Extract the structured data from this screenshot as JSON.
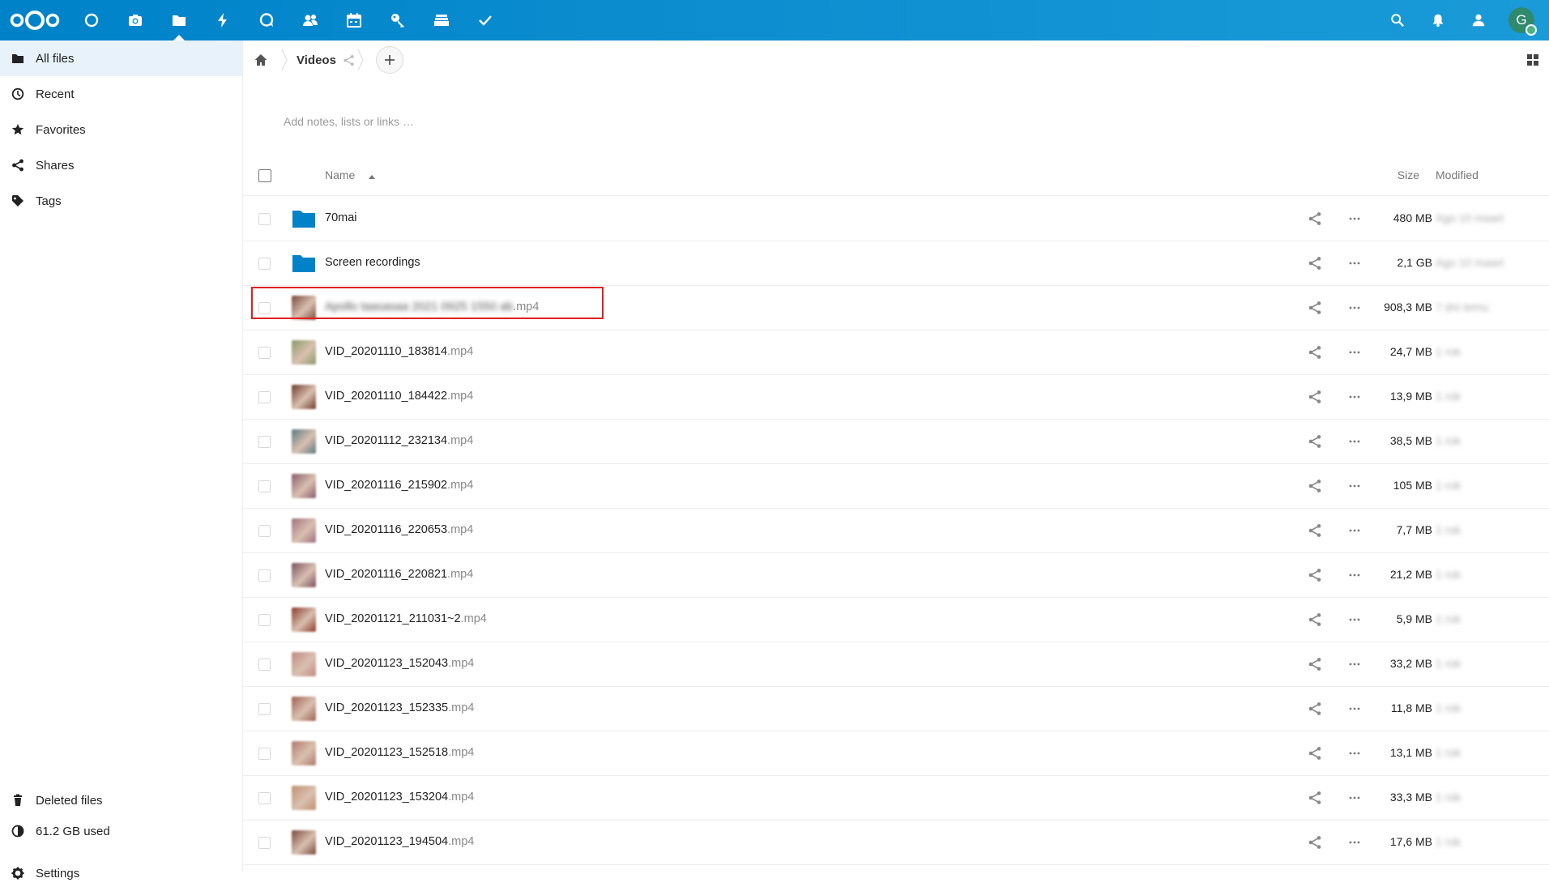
{
  "header": {
    "apps": [
      {
        "icon": "dashboard-icon"
      },
      {
        "icon": "photos-icon"
      },
      {
        "icon": "files-icon",
        "active": true
      },
      {
        "icon": "activity-icon"
      },
      {
        "icon": "talk-icon"
      },
      {
        "icon": "contacts-icon"
      },
      {
        "icon": "calendar-icon"
      },
      {
        "icon": "passwords-icon"
      },
      {
        "icon": "deck-icon"
      },
      {
        "icon": "tasks-icon"
      }
    ],
    "right": [
      "search-icon",
      "notifications-icon",
      "contacts-menu-icon"
    ],
    "avatar_initial": "G"
  },
  "sidebar": {
    "items": [
      {
        "label": "All files",
        "icon": "folder-icon",
        "active": true
      },
      {
        "label": "Recent",
        "icon": "clock-icon"
      },
      {
        "label": "Favorites",
        "icon": "star-icon"
      },
      {
        "label": "Shares",
        "icon": "share-icon"
      },
      {
        "label": "Tags",
        "icon": "tag-icon"
      }
    ],
    "bottom": {
      "deleted": "Deleted files",
      "quota": "61.2 GB used",
      "settings": "Settings"
    }
  },
  "breadcrumb": {
    "current": "Videos"
  },
  "notes_placeholder": "Add notes, lists or links …",
  "table": {
    "headers": {
      "name": "Name",
      "size": "Size",
      "modified": "Modified"
    },
    "rows": [
      {
        "type": "folder",
        "name": "70mai",
        "ext": "",
        "size": "480 MB",
        "modified": "Ago 10 maart",
        "thumb": "#0082c9"
      },
      {
        "type": "folder",
        "name": "Screen recordings",
        "ext": "",
        "size": "2,1 GB",
        "modified": "Ago 10 maart",
        "thumb": "#0082c9"
      },
      {
        "type": "file",
        "name": "Apollo taasasaa 2021 0925 1550 ab",
        "ext": ".mp4",
        "size": "908,3 MB",
        "modified": "7 dni temu",
        "thumb": "#7a4a3c",
        "blurred": true
      },
      {
        "type": "file",
        "name": "VID_20201110_183814",
        "ext": ".mp4",
        "size": "24,7 MB",
        "modified": "1 rok",
        "thumb": "#8a9a6a"
      },
      {
        "type": "file",
        "name": "VID_20201110_184422",
        "ext": ".mp4",
        "size": "13,9 MB",
        "modified": "1 rok",
        "thumb": "#6e3b2a"
      },
      {
        "type": "file",
        "name": "VID_20201112_232134",
        "ext": ".mp4",
        "size": "38,5 MB",
        "modified": "1 rok",
        "thumb": "#5a7a80"
      },
      {
        "type": "file",
        "name": "VID_20201116_215902",
        "ext": ".mp4",
        "size": "105 MB",
        "modified": "1 rok",
        "thumb": "#8a5a6a"
      },
      {
        "type": "file",
        "name": "VID_20201116_220653",
        "ext": ".mp4",
        "size": "7,7 MB",
        "modified": "1 rok",
        "thumb": "#a07080"
      },
      {
        "type": "file",
        "name": "VID_20201116_220821",
        "ext": ".mp4",
        "size": "21,2 MB",
        "modified": "1 rok",
        "thumb": "#7a5060"
      },
      {
        "type": "file",
        "name": "VID_20201121_211031~2",
        "ext": ".mp4",
        "size": "5,9 MB",
        "modified": "1 rok",
        "thumb": "#8a3a2a"
      },
      {
        "type": "file",
        "name": "VID_20201123_152043",
        "ext": ".mp4",
        "size": "33,2 MB",
        "modified": "1 rok",
        "thumb": "#c08a80"
      },
      {
        "type": "file",
        "name": "VID_20201123_152335",
        "ext": ".mp4",
        "size": "11,8 MB",
        "modified": "1 rok",
        "thumb": "#a06050"
      },
      {
        "type": "file",
        "name": "VID_20201123_152518",
        "ext": ".mp4",
        "size": "13,1 MB",
        "modified": "1 rok",
        "thumb": "#b07a6a"
      },
      {
        "type": "file",
        "name": "VID_20201123_153204",
        "ext": ".mp4",
        "size": "33,3 MB",
        "modified": "1 rok",
        "thumb": "#c09070"
      },
      {
        "type": "file",
        "name": "VID_20201123_194504",
        "ext": ".mp4",
        "size": "17,6 MB",
        "modified": "1 rok",
        "thumb": "#7a4a3a"
      }
    ]
  },
  "colors": {
    "brand": "#0082c9",
    "highlight": "#e02020"
  }
}
